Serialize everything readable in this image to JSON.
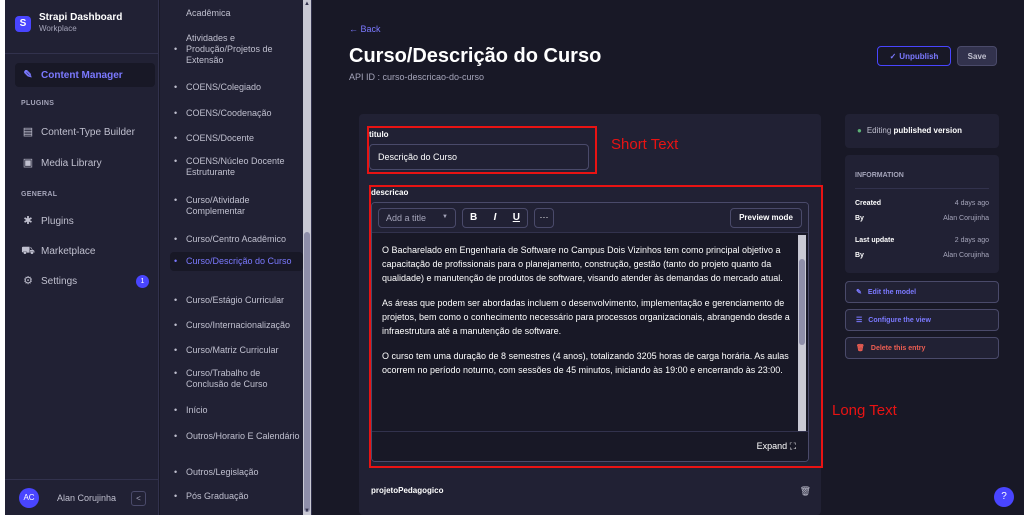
{
  "brand": {
    "title": "Strapi Dashboard",
    "subtitle": "Workplace",
    "logo_glyph": "S"
  },
  "nav": {
    "content_manager": "Content Manager",
    "plugins_header": "PLUGINS",
    "content_type_builder": "Content-Type Builder",
    "media_library": "Media Library",
    "general_header": "GENERAL",
    "plugins": "Plugins",
    "marketplace": "Marketplace",
    "settings": "Settings",
    "settings_badge": "1"
  },
  "user": {
    "initials": "AC",
    "name": "Alan Corujinha",
    "collapse_glyph": "<"
  },
  "subnav": {
    "items": [
      {
        "label": "Acadêmica",
        "bullet": ""
      },
      {
        "label": "Atividades e",
        "bullet": ""
      },
      {
        "label": "Produção/Projetos de Extensão",
        "bullet": "•"
      },
      {
        "label": "COENS/Colegiado",
        "bullet": "•"
      },
      {
        "label": "COENS/Coodenação",
        "bullet": "•"
      },
      {
        "label": "COENS/Docente",
        "bullet": "•"
      },
      {
        "label": "COENS/Núcleo Docente Estruturante",
        "bullet": "•"
      },
      {
        "label": "Curso/Atividade Complementar",
        "bullet": "•"
      },
      {
        "label": "Curso/Centro Acadêmico",
        "bullet": "•"
      },
      {
        "label": "Curso/Descrição do Curso",
        "bullet": "•"
      },
      {
        "label": "Curso/Estágio Curricular",
        "bullet": "•"
      },
      {
        "label": "Curso/Internacionalização",
        "bullet": "•"
      },
      {
        "label": "Curso/Matriz Curricular",
        "bullet": "•"
      },
      {
        "label": "Curso/Trabalho de Conclusão de Curso",
        "bullet": "•"
      },
      {
        "label": "Início",
        "bullet": "•"
      },
      {
        "label": "Outros/Horario E Calendário",
        "bullet": "•"
      },
      {
        "label": "Outros/Legislação",
        "bullet": "•"
      },
      {
        "label": "Pós Graduação",
        "bullet": "•"
      }
    ]
  },
  "header": {
    "back": "Back",
    "title": "Curso/Descrição do Curso",
    "api_id": "API ID : curso-descricao-do-curso",
    "unpublish": "Unpublish",
    "save": "Save"
  },
  "form": {
    "titulo_label": "titulo",
    "titulo_value": "Descrição do Curso",
    "descricao_label": "descricao",
    "toolbar": {
      "add_title": "Add a title",
      "bold": "B",
      "italic": "I",
      "underline": "U",
      "more": "···",
      "preview": "Preview mode"
    },
    "paragraphs": [
      "O Bacharelado em Engenharia de Software no Campus Dois Vizinhos tem como principal objetivo a capacitação de profissionais para o planejamento, construção, gestão (tanto do projeto quanto da qualidade) e manutenção de produtos de software, visando atender às demandas do mercado atual.",
      "As áreas que podem ser abordadas incluem o desenvolvimento, implementação e gerenciamento de projetos, bem como o conhecimento necessário para processos organizacionais, abrangendo desde a infraestrutura até a manutenção de software.",
      "O curso tem uma duração de 8 semestres (4 anos), totalizando 3205 horas de carga horária. As aulas ocorrem no período noturno, com sessões de 45 minutos, iniciando às 19:00 e encerrando às 23:00."
    ],
    "expand": "Expand",
    "projeto_label": "projetoPedagogico"
  },
  "annotations": {
    "short_text": "Short Text",
    "long_text": "Long Text",
    "color": "#e81313"
  },
  "sidebar": {
    "status_prefix": "Editing ",
    "status_bold": "published version",
    "info_title": "INFORMATION",
    "created_label": "Created",
    "created_value": "4 days ago",
    "created_by_label": "By",
    "created_by_value": "Alan Corujinha",
    "updated_label": "Last update",
    "updated_value": "2 days ago",
    "updated_by_label": "By",
    "updated_by_value": "Alan Corujinha",
    "edit_model": "Edit the model",
    "configure_view": "Configure the view",
    "delete_entry": "Delete this entry"
  },
  "help": "?",
  "colors": {
    "accent": "#4945ff",
    "accent_text": "#7b79ff",
    "bg": "#181826",
    "panel": "#212134",
    "danger": "#ee5e52",
    "success": "#5cb176"
  }
}
